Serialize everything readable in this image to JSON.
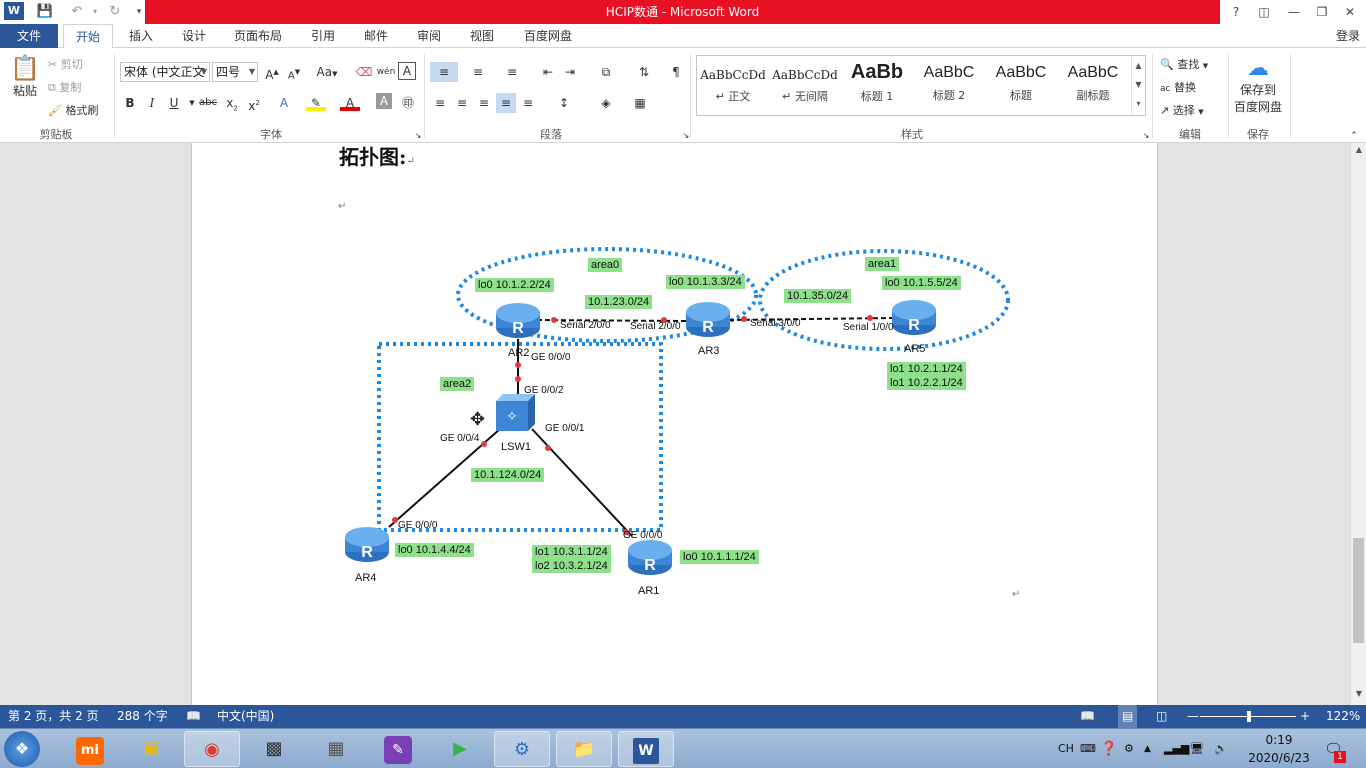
{
  "window": {
    "title": "HCIP数通 -  Microsoft Word",
    "help": "?",
    "signin": "登录"
  },
  "menu": {
    "file": "文件",
    "tabs": [
      "开始",
      "插入",
      "设计",
      "页面布局",
      "引用",
      "邮件",
      "审阅",
      "视图",
      "百度网盘"
    ]
  },
  "ribbon": {
    "clipboard": {
      "paste": "粘贴",
      "cut": "剪切",
      "copy": "复制",
      "format_painter": "格式刷",
      "group": "剪贴板"
    },
    "font": {
      "name": "宋体 (中文正文",
      "size": "四号",
      "group": "字体",
      "wen": "wén"
    },
    "paragraph": {
      "group": "段落"
    },
    "styles": {
      "group": "样式",
      "items": [
        {
          "sample": "AaBbCcDd",
          "name": "↵ 正文"
        },
        {
          "sample": "AaBbCcDd",
          "name": "↵ 无间隔"
        },
        {
          "sample": "AaBb",
          "name": "标题 1"
        },
        {
          "sample": "AaBbC",
          "name": "标题 2"
        },
        {
          "sample": "AaBbC",
          "name": "标题"
        },
        {
          "sample": "AaBbC",
          "name": "副标题"
        }
      ]
    },
    "editing": {
      "find": "查找",
      "replace": "替换",
      "select": "选择",
      "group": "编辑"
    },
    "save": {
      "line1": "保存到",
      "line2": "百度网盘",
      "group": "保存"
    }
  },
  "document": {
    "heading": "拓扑图:",
    "diagram": {
      "areas": [
        "area0",
        "area1",
        "area2"
      ],
      "devices": [
        "AR2",
        "AR3",
        "AR5",
        "LSW1",
        "AR4",
        "AR1"
      ],
      "networks": [
        "10.1.23.0/24",
        "10.1.35.0/24",
        "10.1.124.0/24"
      ],
      "loopbacks": {
        "ar2": "lo0 10.1.2.2/24",
        "ar3": "lo0 10.1.3.3/24",
        "ar5": "lo0 10.1.5.5/24",
        "ar5_lo1": "lo1 10.2.1.1/24",
        "ar5_lo2": "lo1 10.2.2.1/24",
        "ar4": "lo0 10.1.4.4/24",
        "ar1": "lo0 10.1.1.1/24",
        "ar1_lo1": "lo1 10.3.1.1/24",
        "ar1_lo2": "lo2 10.3.2.1/24"
      },
      "interfaces": {
        "ar2_serial": "Serial 2/0/0",
        "ar3_serial_left": "Serial 2/0/0",
        "ar3_serial_right": "Serial 3/0/0",
        "ar5_serial": "Serial 1/0/0",
        "ar2_ge": "GE 0/0/0",
        "lsw_ge2": "GE 0/0/2",
        "lsw_ge4": "GE 0/0/4",
        "lsw_ge1": "GE 0/0/1",
        "ar4_ge": "GE 0/0/0",
        "ar1_ge": "GE 0/0/0"
      }
    }
  },
  "status": {
    "page": "第 2 页，共 2 页",
    "words": "288 个字",
    "lang": "中文(中国)",
    "zoom": "122%"
  },
  "taskbar": {
    "ime": "CH",
    "time": "0:19",
    "date": "2020/6/23",
    "mi": "mi",
    "notif_badge": "1"
  }
}
